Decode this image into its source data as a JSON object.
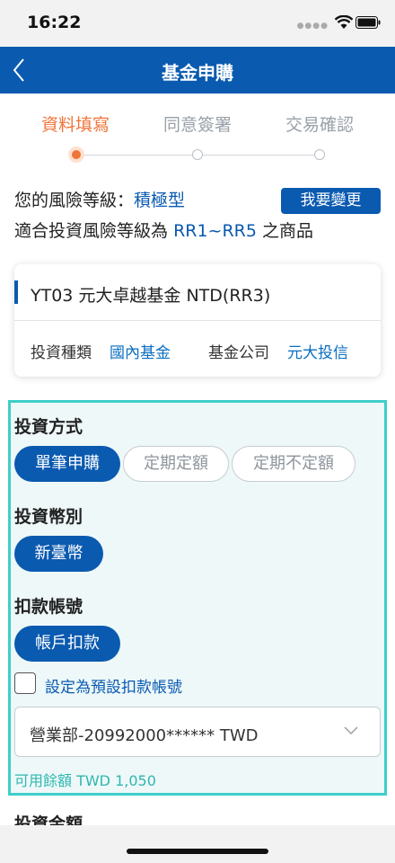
{
  "status_bar": {
    "time": "16:22"
  },
  "nav": {
    "title": "基金申購"
  },
  "steps": [
    {
      "label": "資料填寫",
      "active": true
    },
    {
      "label": "同意簽署",
      "active": false
    },
    {
      "label": "交易確認",
      "active": false
    }
  ],
  "risk": {
    "level_prefix": "您的風險等級：",
    "level_value": "積極型",
    "change_button": "我要變更",
    "range_prefix": "適合投資風險等級為",
    "range_value": "RR1~RR5",
    "range_suffix": "之商品"
  },
  "fund": {
    "name": "YT03 元大卓越基金 NTD(RR3)",
    "type_label": "投資種類",
    "type_value": "國內基金",
    "company_label": "基金公司",
    "company_value": "元大投信"
  },
  "method": {
    "title": "投資方式",
    "options": [
      "單筆申購",
      "定期定額",
      "定期不定額"
    ],
    "selected": "單筆申購"
  },
  "currency": {
    "title": "投資幣別",
    "options": [
      "新臺幣"
    ]
  },
  "debit": {
    "title": "扣款帳號",
    "options": [
      "帳戶扣款"
    ],
    "default_checkbox_label": "設定為預設扣款帳號",
    "account": "營業部-20992000****** TWD",
    "balance": "可用餘額 TWD 1,050"
  },
  "amount": {
    "title": "投資金額"
  },
  "colors": {
    "primary": "#0a5ab0",
    "accent": "#f0743a",
    "highlight": "#3ecfc9"
  }
}
